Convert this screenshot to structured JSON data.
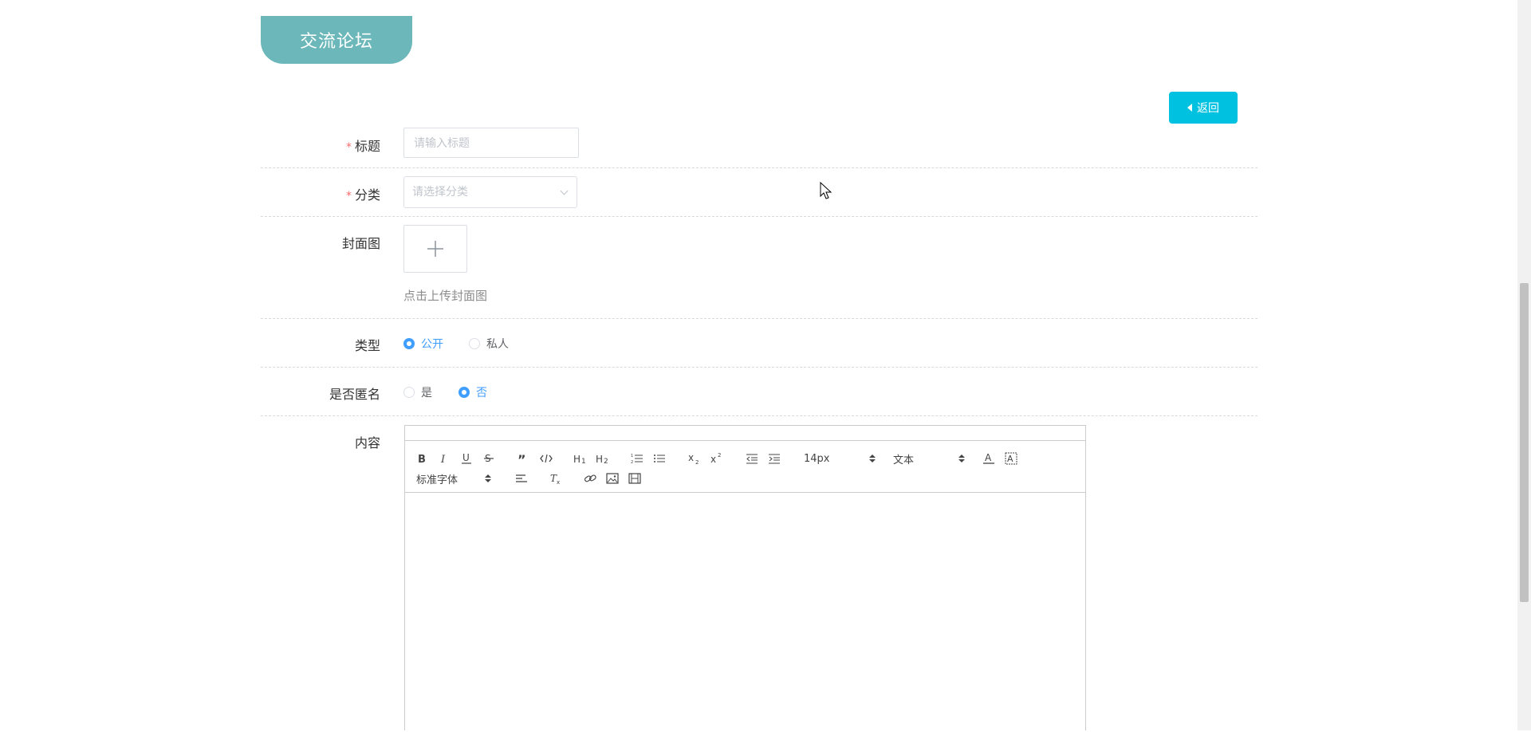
{
  "header": {
    "title": "交流论坛"
  },
  "back_button": {
    "label": "返回"
  },
  "form": {
    "title_field": {
      "label": "标题",
      "placeholder": "请输入标题",
      "required": true
    },
    "category_field": {
      "label": "分类",
      "placeholder": "请选择分类",
      "required": true
    },
    "cover_field": {
      "label": "封面图",
      "hint": "点击上传封面图"
    },
    "type_field": {
      "label": "类型",
      "options": [
        "公开",
        "私人"
      ],
      "selected": "公开"
    },
    "anonymous_field": {
      "label": "是否匿名",
      "options": [
        "是",
        "否"
      ],
      "selected": "否"
    },
    "content_field": {
      "label": "内容"
    }
  },
  "editor_toolbar": {
    "font_size": "14px",
    "header_select": "文本",
    "font_family": "标准字体",
    "buttons": [
      "bold-icon",
      "italic-icon",
      "underline-icon",
      "strike-icon",
      "blockquote-icon",
      "code-block-icon",
      "h1-icon",
      "h2-icon",
      "ordered-list-icon",
      "bullet-list-icon",
      "subscript-icon",
      "superscript-icon",
      "outdent-icon",
      "indent-icon",
      "text-color-icon",
      "background-color-icon",
      "align-icon",
      "clear-format-icon",
      "link-icon",
      "image-icon",
      "video-icon"
    ]
  },
  "colors": {
    "header_bg": "#6bb7b9",
    "back_button_bg": "#00c2e0",
    "accent": "#409eff",
    "required": "#f56c6c"
  }
}
